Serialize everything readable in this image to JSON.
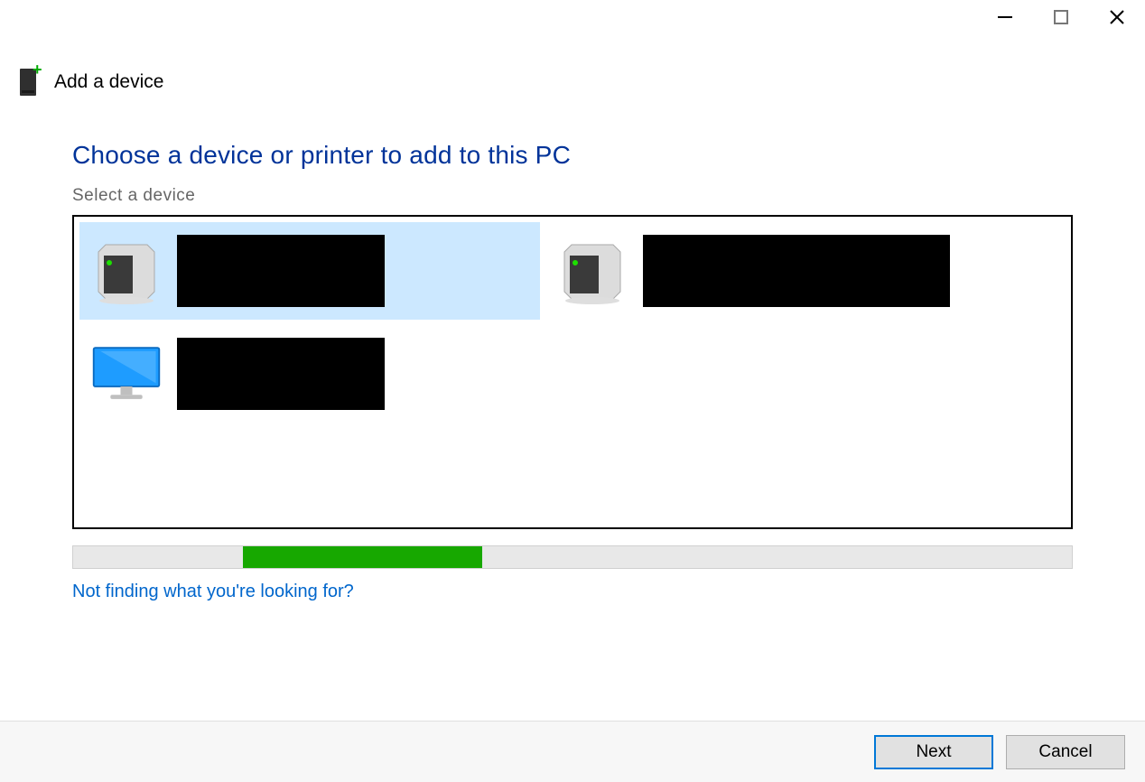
{
  "titlebar": {
    "minimize_icon": "minimize-icon",
    "maximize_icon": "maximize-icon",
    "close_icon": "close-icon"
  },
  "header": {
    "title": "Add a device"
  },
  "main": {
    "heading": "Choose a device or printer to add to this PC",
    "subheading": "Select a device",
    "devices": [
      {
        "selected": true,
        "type": "render-device",
        "label": ""
      },
      {
        "selected": false,
        "type": "render-device",
        "label": ""
      },
      {
        "selected": false,
        "type": "display",
        "label": ""
      }
    ],
    "help_link": "Not finding what you're looking for?"
  },
  "footer": {
    "next_label": "Next",
    "cancel_label": "Cancel"
  }
}
